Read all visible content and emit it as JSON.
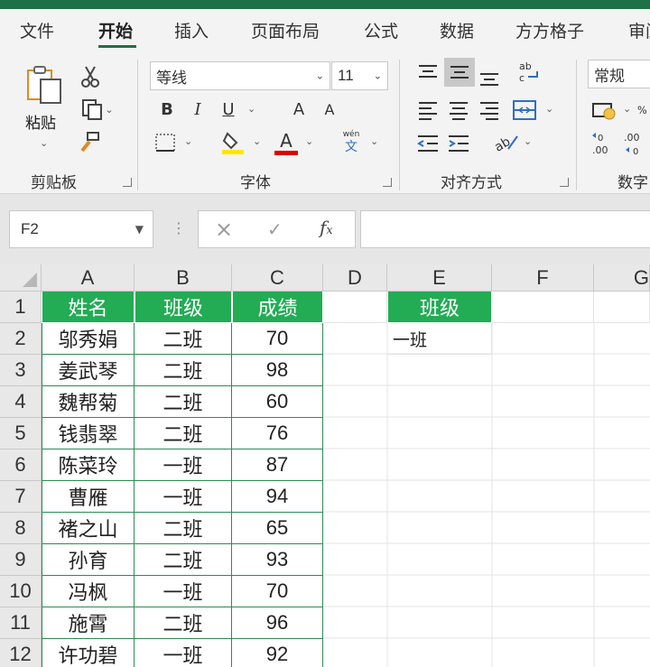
{
  "tabs": [
    {
      "label": "文件",
      "active": false
    },
    {
      "label": "开始",
      "active": true
    },
    {
      "label": "插入",
      "active": false
    },
    {
      "label": "页面布局",
      "active": false
    },
    {
      "label": "公式",
      "active": false
    },
    {
      "label": "数据",
      "active": false
    },
    {
      "label": "方方格子",
      "active": false
    },
    {
      "label": "审阅",
      "active": false
    }
  ],
  "ribbon": {
    "clipboard": {
      "group_label": "剪贴板",
      "paste_label": "粘贴"
    },
    "font": {
      "group_label": "字体",
      "font_name": "等线",
      "font_size": "11",
      "bold": "B",
      "italic": "I",
      "underline": "U",
      "grow": "A",
      "shrink": "A",
      "font_color_letter": "A",
      "pinyin_top": "wén",
      "pinyin_bottom": "文"
    },
    "alignment": {
      "group_label": "对齐方式"
    },
    "number": {
      "group_label": "数字",
      "format": "常规"
    }
  },
  "formula_bar": {
    "name_box": "F2",
    "value": ""
  },
  "colors": {
    "accent_green": "#22ac54",
    "table_border": "#2f8a55",
    "title_bar": "#1e7145"
  },
  "sheet": {
    "columns": [
      "A",
      "B",
      "C",
      "D",
      "E",
      "F",
      "G"
    ],
    "rows": [
      "1",
      "2",
      "3",
      "4",
      "5",
      "6",
      "7",
      "8",
      "9",
      "10",
      "11",
      "12"
    ],
    "table_header": [
      "姓名",
      "班级",
      "成绩"
    ],
    "table_rows": [
      [
        "邬秀娟",
        "二班",
        "70"
      ],
      [
        "姜武琴",
        "二班",
        "98"
      ],
      [
        "魏帮菊",
        "二班",
        "60"
      ],
      [
        "钱翡翠",
        "二班",
        "76"
      ],
      [
        "陈菜玲",
        "一班",
        "87"
      ],
      [
        "曹雁",
        "一班",
        "94"
      ],
      [
        "褚之山",
        "二班",
        "65"
      ],
      [
        "孙育",
        "二班",
        "93"
      ],
      [
        "冯枫",
        "一班",
        "70"
      ],
      [
        "施霄",
        "二班",
        "96"
      ],
      [
        "许功碧",
        "一班",
        "92"
      ]
    ],
    "criteria_header": "班级",
    "criteria_value": "一班"
  }
}
